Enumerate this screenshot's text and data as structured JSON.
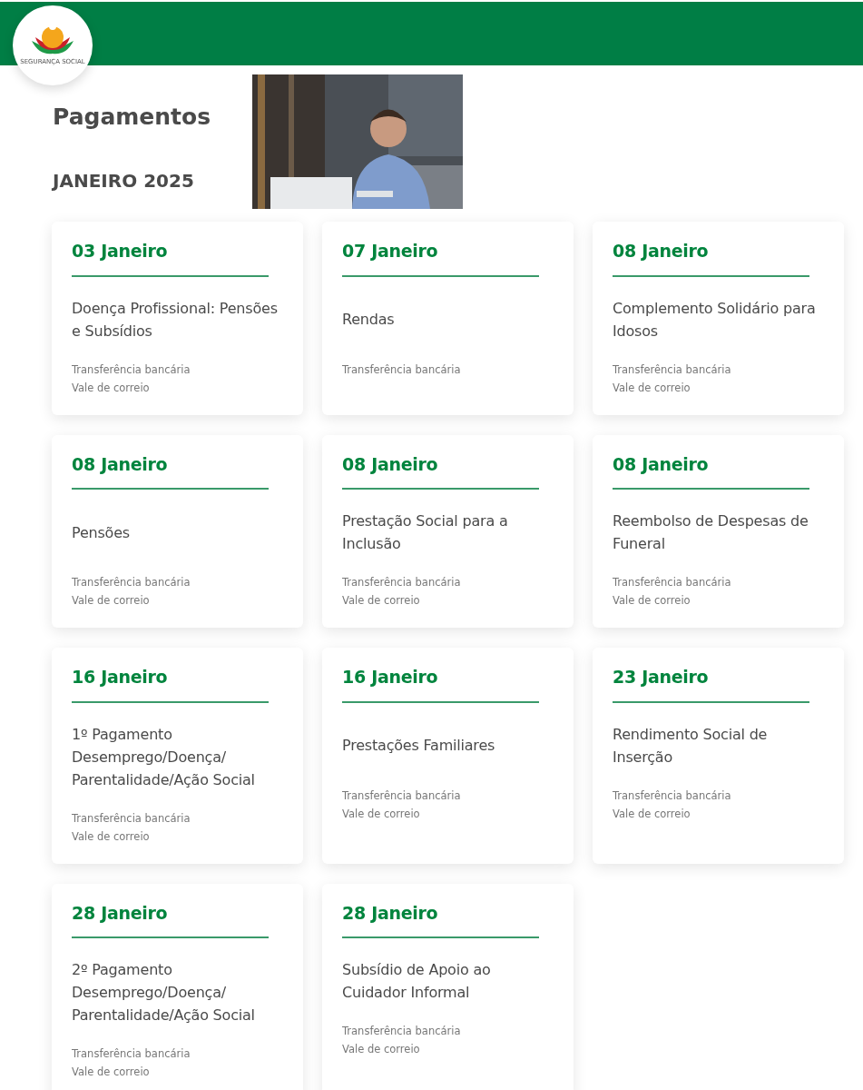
{
  "logo": {
    "text": "SEGURANÇA SOCIAL"
  },
  "heading": {
    "title": "Pagamentos",
    "subtitle": "JANEIRO 2025"
  },
  "cards": [
    {
      "date": "03 Janeiro",
      "title": "Doença Profissional: Pensões e Subsídios",
      "methods": [
        "Transferência bancária",
        "Vale de correio"
      ]
    },
    {
      "date": "07 Janeiro",
      "title": "Rendas",
      "methods": [
        "Transferência bancária"
      ]
    },
    {
      "date": "08 Janeiro",
      "title": "Complemento Solidário para Idosos",
      "methods": [
        "Transferência bancária",
        "Vale de correio"
      ]
    },
    {
      "date": "08 Janeiro",
      "title": "Pensões",
      "methods": [
        "Transferência bancária",
        "Vale de correio"
      ]
    },
    {
      "date": "08 Janeiro",
      "title": "Prestação Social para a Inclusão",
      "methods": [
        "Transferência bancária",
        "Vale de correio"
      ]
    },
    {
      "date": "08 Janeiro",
      "title": "Reembolso de Despesas de Funeral",
      "methods": [
        "Transferência bancária",
        "Vale de correio"
      ]
    },
    {
      "date": "16 Janeiro",
      "title": "1º Pagamento Desemprego/Doença/ Parentalidade/Ação Social",
      "methods": [
        "Transferência bancária",
        "Vale de correio"
      ]
    },
    {
      "date": "16 Janeiro",
      "title": "Prestações Familiares",
      "methods": [
        "Transferência bancária",
        "Vale de correio"
      ]
    },
    {
      "date": "23 Janeiro",
      "title": "Rendimento Social de Inserção",
      "methods": [
        "Transferência bancária",
        "Vale de correio"
      ]
    },
    {
      "date": "28 Janeiro",
      "title": "2º Pagamento Desemprego/Doença/ Parentalidade/Ação Social",
      "methods": [
        "Transferência bancária",
        "Vale de correio"
      ]
    },
    {
      "date": "28 Janeiro",
      "title": "Subsídio de Apoio ao Cuidador Informal",
      "methods": [
        "Transferência bancária",
        "Vale de correio"
      ]
    }
  ]
}
